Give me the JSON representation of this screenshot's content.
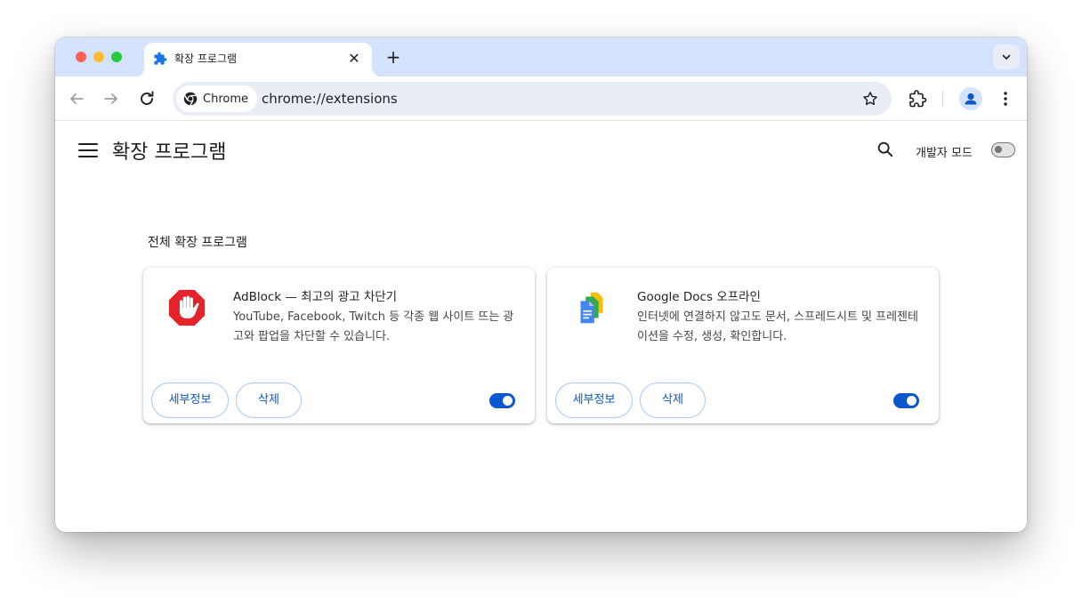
{
  "tab": {
    "title": "확장 프로그램",
    "close_icon": "close-icon",
    "favicon": "puzzle-icon"
  },
  "new_tab_label": "+",
  "toolbar": {
    "back_icon": "arrow-left-icon",
    "forward_icon": "arrow-right-icon",
    "reload_icon": "reload-icon",
    "site_chip_label": "Chrome",
    "url": "chrome://extensions",
    "bookmark_icon": "star-icon",
    "extensions_icon": "puzzle-outline-icon",
    "menu_icon": "kebab-icon"
  },
  "page": {
    "title": "확장 프로그램",
    "developer_mode_label": "개발자 모드",
    "developer_mode_on": false,
    "section_title": "전체 확장 프로그램"
  },
  "extensions": [
    {
      "name": "AdBlock — 최고의 광고 차단기",
      "description": "YouTube, Facebook, Twitch 등 각종 웹 사이트 뜨는 광고와 팝업을 차단할 수 있습니다.",
      "details_label": "세부정보",
      "remove_label": "삭제",
      "enabled": true,
      "icon": "adblock-hand-icon"
    },
    {
      "name": "Google Docs 오프라인",
      "description": "인터넷에 연결하지 않고도 문서, 스프레드시트 및 프레젠테이션을 수정, 생성, 확인합니다.",
      "details_label": "세부정보",
      "remove_label": "삭제",
      "enabled": true,
      "icon": "google-docs-icon"
    }
  ],
  "colors": {
    "tabstrip": "#d3e3fd",
    "accent": "#0b57d0",
    "adblock_red": "#e3242b"
  }
}
